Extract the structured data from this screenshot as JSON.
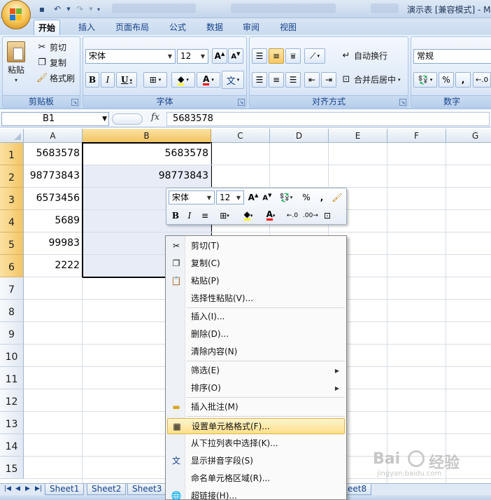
{
  "window": {
    "title": "演示表 [兼容模式] - M"
  },
  "tabs": [
    "开始",
    "插入",
    "页面布局",
    "公式",
    "数据",
    "审阅",
    "视图"
  ],
  "ribbon": {
    "clipboard": {
      "label": "剪贴板",
      "paste": "粘贴",
      "cut": "剪切",
      "copy": "复制",
      "format_painter": "格式刷"
    },
    "font": {
      "label": "字体",
      "font_name": "宋体",
      "font_size": "12",
      "bold": "B",
      "italic": "I",
      "underline": "U"
    },
    "alignment": {
      "label": "对齐方式",
      "wrap": "自动换行",
      "merge": "合并后居中"
    },
    "number": {
      "label": "数字",
      "format": "常规",
      "percent": "%",
      "comma": ","
    }
  },
  "formula_bar": {
    "name_box": "B1",
    "fx": "fx",
    "value": "5683578"
  },
  "grid": {
    "columns": [
      "A",
      "B",
      "C",
      "D",
      "E",
      "F",
      "G"
    ],
    "rows": [
      "1",
      "2",
      "3",
      "4",
      "5",
      "6",
      "7",
      "8",
      "9",
      "10",
      "11",
      "12",
      "13",
      "14",
      "15"
    ],
    "col_a": [
      "5683578",
      "98773843",
      "6573456",
      "5689",
      "99983",
      "2222"
    ],
    "col_b": [
      "5683578",
      "98773843"
    ]
  },
  "mini_toolbar": {
    "font_name": "宋体",
    "font_size": "12",
    "percent": "%",
    "comma": ",",
    "bold": "B",
    "italic": "I"
  },
  "context_menu": {
    "items": [
      "剪切(T)",
      "复制(C)",
      "粘贴(P)",
      "选择性粘贴(V)...",
      "插入(I)...",
      "删除(D)...",
      "清除内容(N)",
      "筛选(E)",
      "排序(O)",
      "插入批注(M)",
      "设置单元格格式(F)...",
      "从下拉列表中选择(K)...",
      "显示拼音字段(S)",
      "命名单元格区域(R)...",
      "超链接(H)..."
    ]
  },
  "sheets": [
    "Sheet1",
    "Sheet2",
    "Sheet3",
    "eet8"
  ],
  "watermark": {
    "brand_left": "Bai",
    "brand_right": "经验",
    "domain": "jingyan.baidu.com"
  },
  "colors": {
    "selection_header": "#f3c465",
    "selection_range": "#e7ecf6",
    "menu_highlight": "#fde08b",
    "ribbon_text": "#15428b"
  }
}
